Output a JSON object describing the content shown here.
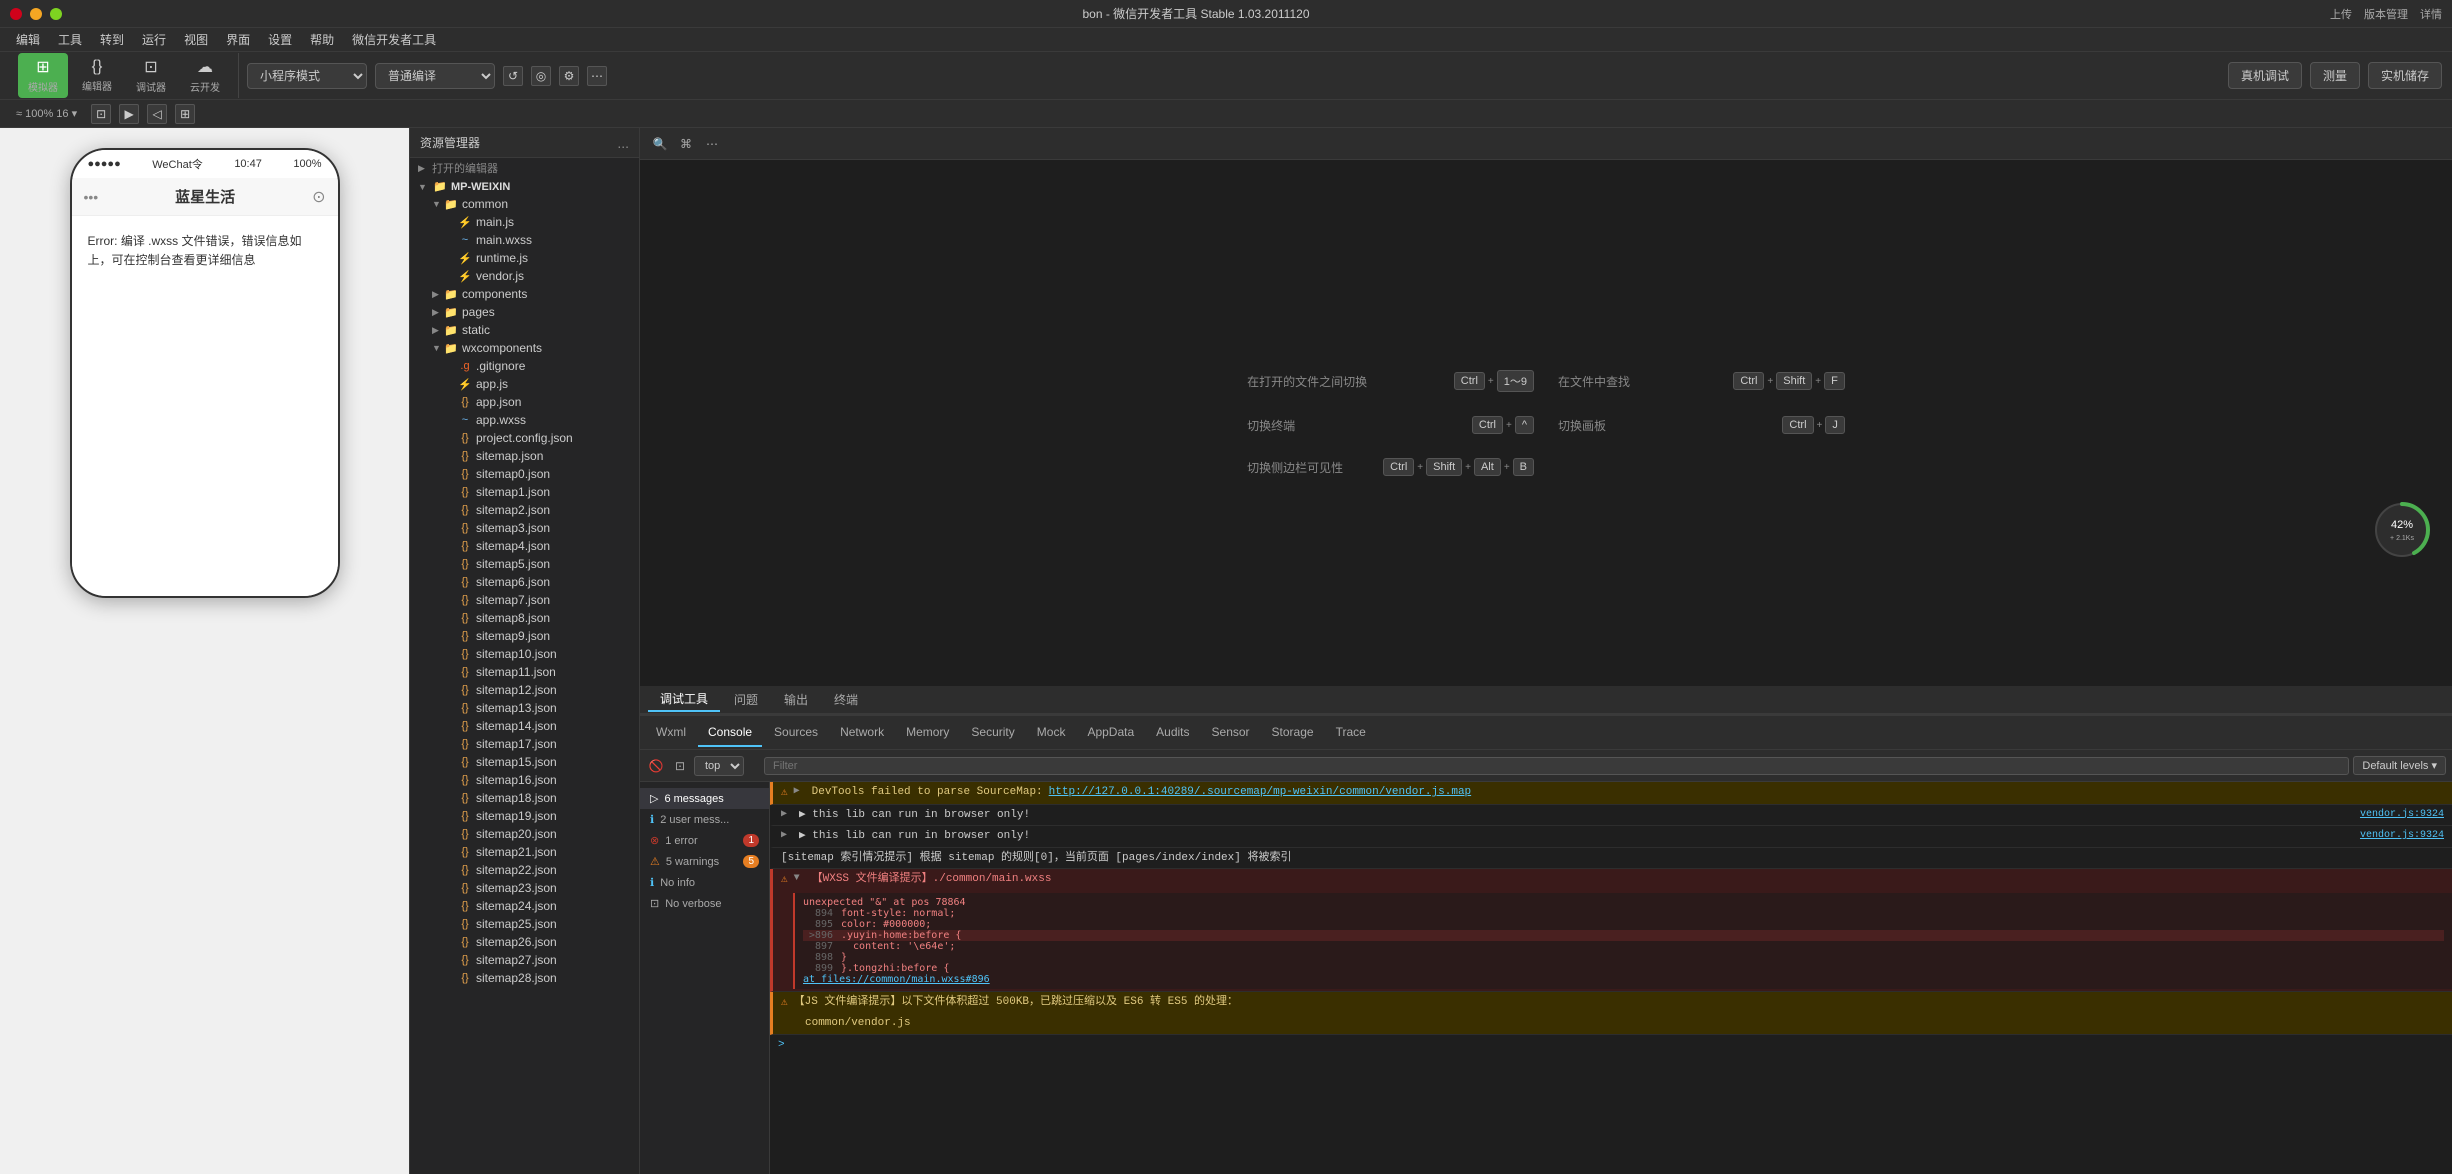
{
  "window": {
    "title": "bon - 微信开发者工具 Stable 1.03.2011120",
    "controls": [
      "上传",
      "版本管理",
      "详情"
    ]
  },
  "menubar": {
    "items": [
      "编辑",
      "工具",
      "转到",
      "运行",
      "视图",
      "界面",
      "设置",
      "帮助",
      "微信开发者工具"
    ]
  },
  "toolbar": {
    "buttons": [
      {
        "id": "simulator",
        "icon": "□",
        "label": "模拟器"
      },
      {
        "id": "editor",
        "icon": "{}",
        "label": "编辑器"
      },
      {
        "id": "debugger",
        "icon": "<>",
        "label": "调试器"
      },
      {
        "id": "cloud",
        "icon": "☁",
        "label": "云开发"
      }
    ],
    "mode_select": "小程序模式",
    "compile_select": "普通编译",
    "right_buttons": [
      "真机调试",
      "测量",
      "实机储存"
    ]
  },
  "secondary_toolbar": {
    "zoom": "≈ 100% 16 ▾"
  },
  "simulator": {
    "status_dots": "●●●●●",
    "network": "WeChat令",
    "time": "10:47",
    "battery": "100%",
    "title": "蓝星生活",
    "error_text": "Error: 编译 .wxss 文件错误，错误信息如上，可在控制台查看更详细信息"
  },
  "filetree": {
    "header": "资源管理器",
    "more_icon": "...",
    "root_section": "打开的编辑器",
    "project": "MP-WEIXIN",
    "items": [
      {
        "type": "folder",
        "name": "common",
        "level": 1,
        "expanded": true
      },
      {
        "type": "js",
        "name": "main.js",
        "level": 2
      },
      {
        "type": "wxss",
        "name": "main.wxss",
        "level": 2
      },
      {
        "type": "js",
        "name": "runtime.js",
        "level": 2
      },
      {
        "type": "js",
        "name": "vendor.js",
        "level": 2
      },
      {
        "type": "folder",
        "name": "components",
        "level": 1
      },
      {
        "type": "folder",
        "name": "pages",
        "level": 1
      },
      {
        "type": "folder",
        "name": "static",
        "level": 1
      },
      {
        "type": "folder",
        "name": "wxcomponents",
        "level": 1,
        "expanded": true
      },
      {
        "type": "gitignore",
        "name": ".gitignore",
        "level": 2
      },
      {
        "type": "js",
        "name": "app.js",
        "level": 2
      },
      {
        "type": "json",
        "name": "app.json",
        "level": 2
      },
      {
        "type": "wxss",
        "name": "app.wxss",
        "level": 2
      },
      {
        "type": "json",
        "name": "project.config.json",
        "level": 2
      },
      {
        "type": "json",
        "name": "sitemap.json",
        "level": 2
      },
      {
        "type": "json",
        "name": "sitemap0.json",
        "level": 2
      },
      {
        "type": "json",
        "name": "sitemap1.json",
        "level": 2
      },
      {
        "type": "json",
        "name": "sitemap2.json",
        "level": 2
      },
      {
        "type": "json",
        "name": "sitemap3.json",
        "level": 2
      },
      {
        "type": "json",
        "name": "sitemap4.json",
        "level": 2
      },
      {
        "type": "json",
        "name": "sitemap5.json",
        "level": 2
      },
      {
        "type": "json",
        "name": "sitemap6.json",
        "level": 2
      },
      {
        "type": "json",
        "name": "sitemap7.json",
        "level": 2
      },
      {
        "type": "json",
        "name": "sitemap8.json",
        "level": 2
      },
      {
        "type": "json",
        "name": "sitemap9.json",
        "level": 2
      },
      {
        "type": "json",
        "name": "sitemap10.json",
        "level": 2
      },
      {
        "type": "json",
        "name": "sitemap11.json",
        "level": 2
      },
      {
        "type": "json",
        "name": "sitemap12.json",
        "level": 2
      },
      {
        "type": "json",
        "name": "sitemap13.json",
        "level": 2
      },
      {
        "type": "json",
        "name": "sitemap14.json",
        "level": 2
      },
      {
        "type": "json",
        "name": "sitemap17.json",
        "level": 2
      },
      {
        "type": "json",
        "name": "sitemap15.json",
        "level": 2
      },
      {
        "type": "json",
        "name": "sitemap16.json",
        "level": 2
      },
      {
        "type": "json",
        "name": "sitemap18.json",
        "level": 2
      },
      {
        "type": "json",
        "name": "sitemap19.json",
        "level": 2
      },
      {
        "type": "json",
        "name": "sitemap20.json",
        "level": 2
      },
      {
        "type": "json",
        "name": "sitemap21.json",
        "level": 2
      },
      {
        "type": "json",
        "name": "sitemap22.json",
        "level": 2
      },
      {
        "type": "json",
        "name": "sitemap23.json",
        "level": 2
      },
      {
        "type": "json",
        "name": "sitemap24.json",
        "level": 2
      },
      {
        "type": "json",
        "name": "sitemap25.json",
        "level": 2
      },
      {
        "type": "json",
        "name": "sitemap26.json",
        "level": 2
      },
      {
        "type": "json",
        "name": "sitemap27.json",
        "level": 2
      },
      {
        "type": "json",
        "name": "sitemap28.json",
        "level": 2
      }
    ]
  },
  "shortcuts": [
    {
      "desc": "在打开的文件之间切换",
      "keys": [
        "Ctrl",
        "1~9"
      ]
    },
    {
      "desc": "在文件中查找",
      "keys": [
        "Ctrl",
        "Shift",
        "F"
      ]
    },
    {
      "desc": "切换终端",
      "keys": [
        "Ctrl",
        "^"
      ]
    },
    {
      "desc": "切换画板",
      "keys": [
        "Ctrl",
        "J"
      ]
    },
    {
      "desc": "切换侧边栏可见性",
      "keys": [
        "Ctrl",
        "Shift",
        "Alt",
        "B"
      ]
    }
  ],
  "panel_tabs": {
    "items": [
      "调试工具",
      "问题",
      "输出",
      "终端"
    ],
    "active": "调试工具"
  },
  "devtools": {
    "tabs": [
      "Wxml",
      "Console",
      "Sources",
      "Network",
      "Memory",
      "Security",
      "Mock",
      "AppData",
      "Audits",
      "Sensor",
      "Storage",
      "Trace"
    ],
    "active_tab": "Console",
    "toolbar": {
      "level_select": "top",
      "filter_placeholder": "Filter",
      "default_levels": "Default levels ▾"
    },
    "sidebar": {
      "items": [
        {
          "label": "6 messages",
          "count": ""
        },
        {
          "label": "2 user mess...",
          "count": "",
          "icon": "info"
        },
        {
          "label": "1 error",
          "count": "1",
          "icon": "error"
        },
        {
          "label": "5 warnings",
          "count": "5",
          "icon": "warn"
        },
        {
          "label": "No info",
          "count": ""
        },
        {
          "label": "No verbose",
          "count": ""
        }
      ]
    },
    "console_messages": [
      {
        "type": "warn",
        "expandable": true,
        "message": "DevTools failed to parse SourceMap: ",
        "link": "http://127.0.0.1:40289/.sourcemap/mp-weixin/common/vendor.js.map",
        "source": ""
      },
      {
        "type": "info",
        "expandable": false,
        "message": "▶ this lib can run in browser only!",
        "source": "vendor.js:9324"
      },
      {
        "type": "info",
        "expandable": false,
        "message": "▶ this lib can run in browser only!",
        "source": "vendor.js:9324"
      },
      {
        "type": "info",
        "expandable": false,
        "message": "[sitemap 索引情况提示] 根据 sitemap 的规则[0]，当前页面 [pages/index/index] 将被索引",
        "source": ""
      },
      {
        "type": "error",
        "expandable": true,
        "message": "【WXSS 文件编译提示】./common/main.wxss",
        "code_lines": [
          {
            "num": "894",
            "content": "unexpected \"&\" at pos 78864"
          },
          {
            "num": "895",
            "content": "font-style: normal;"
          },
          {
            "num": "896",
            "content": "color: #000000;"
          },
          {
            "num": ">896",
            "content": ".yuyin-home:before {",
            "highlight": true
          },
          {
            "num": "897",
            "content": "  content: '\\e64e';"
          },
          {
            "num": "898",
            "content": "}"
          },
          {
            "num": "899",
            "content": "}.tongzhi:before {"
          }
        ],
        "at_line": "at files://common/main.wxss#896"
      },
      {
        "type": "warn",
        "expandable": false,
        "message": "【JS 文件编译提示】以下文件体积超过 500KB，已跳过压缩以及 ES6 转 ES5 的处理：",
        "sub": "common/vendor.js"
      }
    ],
    "prompt": ">"
  },
  "perf": {
    "value": "42%",
    "sub": "+ 2.1Ks"
  }
}
